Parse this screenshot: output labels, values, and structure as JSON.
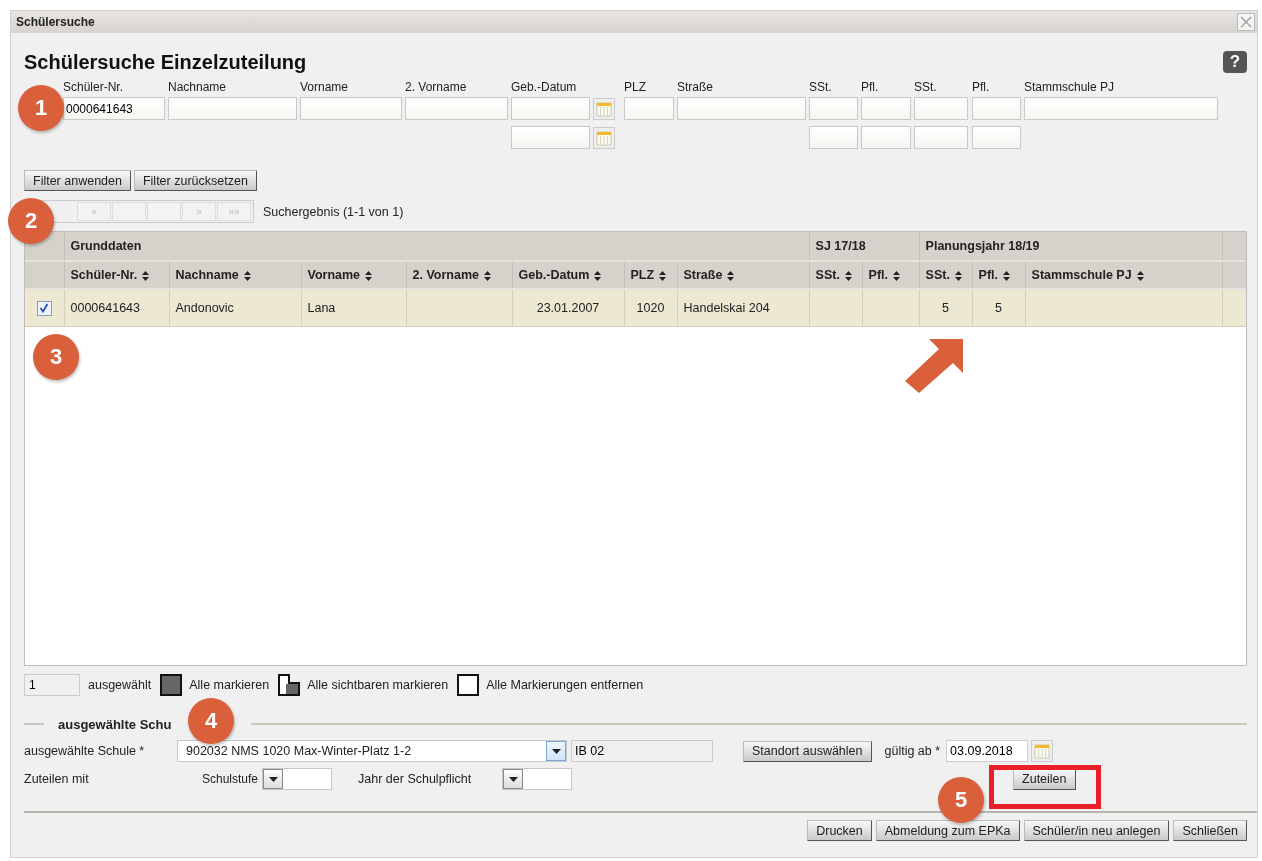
{
  "window": {
    "title": "Schülersuche"
  },
  "heading": "Schülersuche Einzelzuteilung",
  "help_button": "?",
  "filters": [
    {
      "kind": "text",
      "label": "Schüler-Nr.",
      "value": "0000641643"
    },
    {
      "kind": "text",
      "label": "Nachname"
    },
    {
      "kind": "text",
      "label": "Vorname"
    },
    {
      "kind": "text",
      "label": "2. Vorname"
    },
    {
      "kind": "date_range",
      "label": "Geb.-Datum"
    },
    {
      "kind": "text",
      "label": "PLZ"
    },
    {
      "kind": "text",
      "label": "Straße"
    },
    {
      "kind": "range",
      "label": "SSt."
    },
    {
      "kind": "range",
      "label": "Pfl."
    },
    {
      "kind": "range",
      "label": "SSt."
    },
    {
      "kind": "range",
      "label": "Pfl."
    },
    {
      "kind": "text",
      "label": "Stammschule PJ"
    }
  ],
  "filter_buttons": [
    "Filter anwenden",
    "Filter zurücksetzen"
  ],
  "pager": {
    "buttons": [
      {
        "kind": "glyph",
        "label": "«"
      },
      {
        "kind": "blank"
      },
      {
        "kind": "blank"
      },
      {
        "kind": "glyph",
        "label": "»"
      },
      {
        "kind": "glyph",
        "label": "»»"
      }
    ],
    "result": "Suchergebnis (1-1 von 1)"
  },
  "table": {
    "groups": [
      "Grunddaten",
      "SJ 17/18",
      "Planungsjahr 18/19"
    ],
    "columns": [
      "Schüler-Nr.",
      "Nachname",
      "Vorname",
      "2. Vorname",
      "Geb.-Datum",
      "PLZ",
      "Straße",
      "SSt.",
      "Pfl.",
      "SSt.",
      "Pfl.",
      "Stammschule PJ"
    ],
    "rows": [
      {
        "selected": true,
        "schueler_nr": "0000641643",
        "nachname": "Andonovic",
        "vorname": "Lana",
        "geb_datum": "23.01.2007",
        "plz": "1020",
        "strasse": "Handelskai 204",
        "sst_planungsjahr": "5",
        "pfl_planungsjahr": "5"
      }
    ]
  },
  "selection": {
    "count": "1",
    "label": "ausgewählt",
    "actions": [
      {
        "kind": "all",
        "label": "Alle markieren"
      },
      {
        "kind": "visible",
        "label": "Alle sichtbaren markieren"
      },
      {
        "kind": "none",
        "label": "Alle Markierungen entfernen"
      }
    ]
  },
  "school_section": {
    "legend": "ausgewählte Schu",
    "school_label": "ausgewählte Schule *",
    "school_value": "902032 NMS 1020 Max-Winter-Platz 1-2",
    "code_value": "IB 02",
    "location_button": "Standort auswählen",
    "valid_label": "gültig ab *",
    "valid_value": "03.09.2018",
    "assign_label": "Zuteilen mit",
    "level_label": "Schulstufe",
    "year_label": "Jahr der Schulpflicht",
    "assign_button": "Zuteilen"
  },
  "footer_buttons": [
    "Drucken",
    "Abmeldung zum EPKa",
    "Schüler/in neu anlegen",
    "Schließen"
  ],
  "annotations": [
    {
      "kind": "step",
      "label": "1"
    },
    {
      "kind": "step",
      "label": "2"
    },
    {
      "kind": "step",
      "label": "3"
    },
    {
      "kind": "step",
      "label": "4"
    },
    {
      "kind": "step",
      "label": "5"
    },
    {
      "kind": "arrow"
    },
    {
      "kind": "highlight"
    }
  ]
}
